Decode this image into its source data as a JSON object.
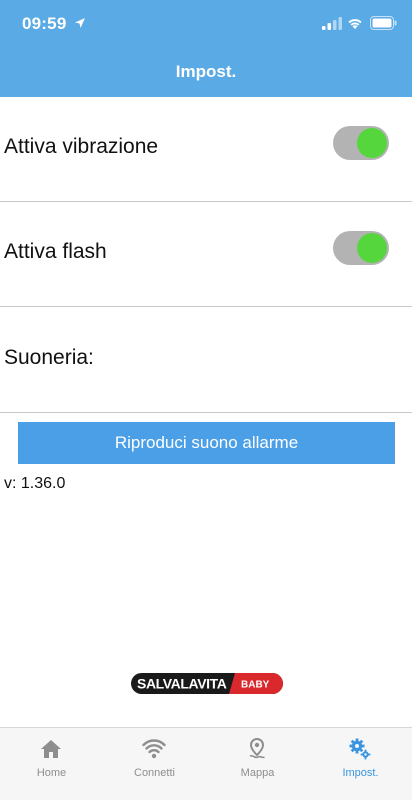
{
  "status_bar": {
    "time": "09:59"
  },
  "header": {
    "title": "Impost."
  },
  "settings": {
    "vibration_label": "Attiva vibrazione",
    "vibration_on": true,
    "flash_label": "Attiva flash",
    "flash_on": true,
    "ringtone_label": "Suoneria:"
  },
  "play_button_label": "Riproduci suono allarme",
  "version": "v: 1.36.0",
  "logo": {
    "text": "SALVALAVITA",
    "badge": "BABY"
  },
  "colors": {
    "header": "#5aaae6",
    "button": "#4a9fe6",
    "toggle_knob": "#56d63d",
    "tab_active": "#3a95e0",
    "tab_inactive": "#8e8e8e",
    "logo_red": "#d9292c"
  },
  "tabs": [
    {
      "label": "Home",
      "icon": "home-icon",
      "active": false
    },
    {
      "label": "Connetti",
      "icon": "wifi-icon",
      "active": false
    },
    {
      "label": "Mappa",
      "icon": "map-pin-icon",
      "active": false
    },
    {
      "label": "Impost.",
      "icon": "gears-icon",
      "active": true
    }
  ]
}
